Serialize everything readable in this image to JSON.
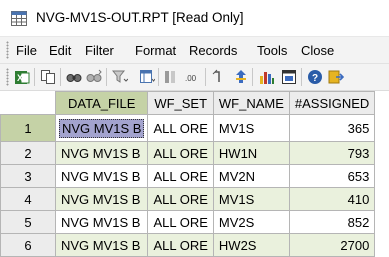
{
  "window": {
    "title": "NVG-MV1S-OUT.RPT [Read Only]"
  },
  "menu": {
    "items": [
      "File",
      "Edit",
      "Filter",
      "Format",
      "Records",
      "Tools",
      "Close"
    ]
  },
  "toolbar": {
    "icons": [
      "export-excel-icon",
      "copy-icon",
      "find-icon",
      "find-next-icon",
      "filter-icon",
      "columns-icon",
      "insert-column-icon",
      "decimal-places-icon",
      "sort-icon",
      "chart-icon",
      "report-icon",
      "help-icon",
      "exit-icon"
    ]
  },
  "grid": {
    "columns": [
      "DATA_FILE",
      "WF_SET",
      "WF_NAME",
      "#ASSIGNED"
    ],
    "sorted_column": "DATA_FILE",
    "selected_row": 1,
    "rows": [
      {
        "num": "1",
        "data_file": "NVG MV1S B",
        "wf_set": "ALL ORE",
        "wf_name": "MV1S",
        "assigned": "365"
      },
      {
        "num": "2",
        "data_file": "NVG MV1S B",
        "wf_set": "ALL ORE",
        "wf_name": "HW1N",
        "assigned": "793"
      },
      {
        "num": "3",
        "data_file": "NVG MV1S B",
        "wf_set": "ALL ORE",
        "wf_name": "MV2N",
        "assigned": "653"
      },
      {
        "num": "4",
        "data_file": "NVG MV1S B",
        "wf_set": "ALL ORE",
        "wf_name": "MV1S",
        "assigned": "410"
      },
      {
        "num": "5",
        "data_file": "NVG MV1S B",
        "wf_set": "ALL ORE",
        "wf_name": "MV2S",
        "assigned": "852"
      },
      {
        "num": "6",
        "data_file": "NVG MV1S B",
        "wf_set": "ALL ORE",
        "wf_name": "HW2S",
        "assigned": "2700"
      }
    ]
  },
  "colors": {
    "row_alt_green": "#eaf1dd",
    "active_header_green": "#c5d2a6",
    "selection_purple": "#a3a3ce"
  }
}
